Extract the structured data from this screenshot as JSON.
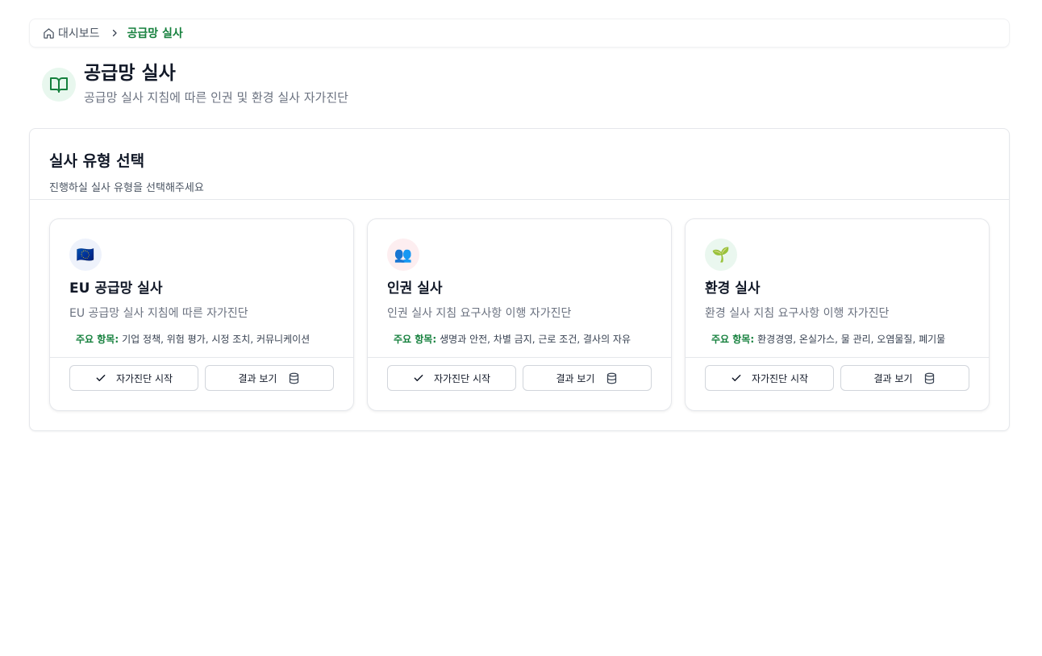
{
  "breadcrumb": {
    "home_label": "대시보드",
    "current_label": "공급망 실사"
  },
  "header": {
    "title": "공급망 실사",
    "subtitle": "공급망 실사 지침에 따른 인권 및 환경 실사 자가진단",
    "icon": "book-open-icon"
  },
  "panel": {
    "title": "실사 유형 선택",
    "description": "진행하실 실사 유형을 선택해주세요"
  },
  "cards": [
    {
      "icon": "🇪🇺",
      "icon_bg": "#eef2fb",
      "title": "EU 공급망 실사",
      "description": "EU 공급망 실사 지침에 따른 자가진단",
      "items_label": "주요 항목:",
      "items": "기업 정책, 위험 평가, 시정 조치, 커뮤니케이션",
      "start_label": "자가진단 시작",
      "results_label": "결과 보기"
    },
    {
      "icon": "👥",
      "icon_bg": "#fdeef0",
      "title": "인권 실사",
      "description": "인권 실사 지침 요구사항 이행 자가진단",
      "items_label": "주요 항목:",
      "items": "생명과 안전, 차별 금지, 근로 조건, 결사의 자유",
      "start_label": "자가진단 시작",
      "results_label": "결과 보기"
    },
    {
      "icon": "🌱",
      "icon_bg": "#eaf7ef",
      "title": "환경 실사",
      "description": "환경 실사 지침 요구사항 이행 자가진단",
      "items_label": "주요 항목:",
      "items": "환경경영, 온실가스, 물 관리, 오염물질, 폐기물",
      "start_label": "자가진단 시작",
      "results_label": "결과 보기"
    }
  ],
  "colors": {
    "accent": "#15803d",
    "border": "#e5e7eb",
    "muted_text": "#6b7280"
  }
}
